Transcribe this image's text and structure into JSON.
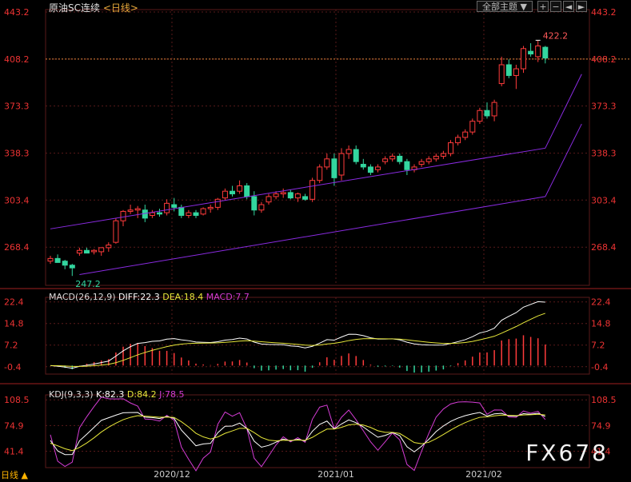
{
  "header": {
    "instrument": "原油SC连续",
    "period": "<日线>",
    "theme_button": "全部主题",
    "theme_arrow": "▼",
    "tool_icons": [
      "plus-icon",
      "minus-icon",
      "left-icon",
      "right-icon"
    ]
  },
  "macd": {
    "label": "MACD(26,12,9)",
    "diff": "DIFF:22.3",
    "dea": "DEA:18.4",
    "macd": "MACD:7.7"
  },
  "kdj": {
    "label": "KDJ(9,3,3)",
    "k": "K:82.3",
    "d": "D:84.2",
    "j": "J:78.5"
  },
  "watermark": "FX678",
  "corner": "日线 ▲",
  "colors": {
    "up": "#ff3b3b",
    "down": "#33d69f",
    "grid": "#5a1a1a",
    "channel": "#8a2be2",
    "diff": "#ffffff",
    "dea": "#e8e83a",
    "j": "#d43cd4",
    "axis": "#e33"
  },
  "chart_data": [
    {
      "type": "candlestick",
      "title": "原油SC连续 <日线>",
      "ylim": [
        240,
        445
      ],
      "yticks": [
        "443.2",
        "408.2",
        "373.3",
        "338.3",
        "303.4",
        "268.4"
      ],
      "xticks": [
        "2020/12",
        "2021/01",
        "2021/02"
      ],
      "annotations": {
        "high": "422.2",
        "low": "247.2"
      },
      "last_price": "408.2",
      "candles": [
        [
          258,
          262,
          256,
          260
        ],
        [
          260,
          263,
          258,
          257
        ],
        [
          258,
          259,
          252,
          255
        ],
        [
          255,
          256,
          247,
          253
        ],
        [
          264,
          268,
          262,
          266
        ],
        [
          266,
          268,
          264,
          264
        ],
        [
          265,
          267,
          263,
          266
        ],
        [
          265,
          268,
          262,
          268
        ],
        [
          268,
          272,
          265,
          270
        ],
        [
          272,
          290,
          271,
          288
        ],
        [
          288,
          296,
          284,
          295
        ],
        [
          295,
          300,
          293,
          296
        ],
        [
          296,
          299,
          290,
          297
        ],
        [
          296,
          300,
          287,
          290
        ],
        [
          292,
          296,
          290,
          294
        ],
        [
          294,
          297,
          291,
          293
        ],
        [
          294,
          304,
          292,
          301
        ],
        [
          300,
          305,
          295,
          298
        ],
        [
          298,
          300,
          290,
          292
        ],
        [
          292,
          296,
          290,
          294
        ],
        [
          294,
          296,
          290,
          292
        ],
        [
          293,
          298,
          292,
          297
        ],
        [
          297,
          300,
          294,
          298
        ],
        [
          298,
          305,
          296,
          304
        ],
        [
          305,
          312,
          303,
          310
        ],
        [
          310,
          314,
          306,
          308
        ],
        [
          310,
          318,
          308,
          314
        ],
        [
          314,
          316,
          304,
          306
        ],
        [
          306,
          310,
          292,
          296
        ],
        [
          296,
          302,
          294,
          300
        ],
        [
          302,
          308,
          300,
          306
        ],
        [
          306,
          310,
          304,
          308
        ],
        [
          308,
          312,
          305,
          309
        ],
        [
          309,
          311,
          304,
          305
        ],
        [
          305,
          309,
          302,
          308
        ],
        [
          306,
          308,
          303,
          304
        ],
        [
          304,
          320,
          302,
          318
        ],
        [
          318,
          330,
          316,
          328
        ],
        [
          328,
          338,
          326,
          334
        ],
        [
          334,
          338,
          314,
          320
        ],
        [
          322,
          342,
          318,
          338
        ],
        [
          338,
          344,
          334,
          341
        ],
        [
          341,
          344,
          330,
          332
        ],
        [
          330,
          334,
          326,
          328
        ],
        [
          328,
          330,
          322,
          324
        ],
        [
          326,
          330,
          324,
          328
        ],
        [
          332,
          336,
          330,
          334
        ],
        [
          334,
          338,
          332,
          336
        ],
        [
          336,
          338,
          330,
          332
        ],
        [
          332,
          334,
          322,
          326
        ],
        [
          326,
          330,
          324,
          328
        ],
        [
          330,
          334,
          328,
          332
        ],
        [
          332,
          336,
          330,
          334
        ],
        [
          334,
          338,
          332,
          336
        ],
        [
          336,
          340,
          334,
          338
        ],
        [
          338,
          348,
          336,
          346
        ],
        [
          346,
          352,
          344,
          350
        ],
        [
          350,
          356,
          348,
          354
        ],
        [
          354,
          364,
          352,
          362
        ],
        [
          362,
          372,
          360,
          370
        ],
        [
          370,
          376,
          364,
          366
        ],
        [
          366,
          378,
          362,
          376
        ],
        [
          390,
          410,
          388,
          404
        ],
        [
          404,
          408,
          394,
          396
        ],
        [
          396,
          404,
          386,
          401
        ],
        [
          401,
          418,
          398,
          416
        ],
        [
          414,
          420,
          410,
          412
        ],
        [
          410,
          422,
          406,
          418
        ],
        [
          417,
          418,
          405,
          409
        ]
      ],
      "channel": {
        "upper": [
          [
            0,
            282
          ],
          [
            68,
            342
          ],
          [
            73,
            397
          ]
        ],
        "lower": [
          [
            4,
            248
          ],
          [
            68,
            306
          ],
          [
            73,
            360
          ]
        ]
      }
    },
    {
      "type": "line+bar",
      "title": "MACD(26,12,9)",
      "ylim": [
        -3,
        24
      ],
      "yticks": [
        "22.4",
        "14.8",
        "7.2",
        "-0.4"
      ],
      "series": [
        {
          "name": "DIFF",
          "values": []
        },
        {
          "name": "DEA",
          "values": []
        },
        {
          "name": "MACD",
          "values": []
        }
      ]
    },
    {
      "type": "line",
      "title": "KDJ(9,3,3)",
      "ylim": [
        20,
        115
      ],
      "yticks": [
        "108.5",
        "74.9",
        "41.4"
      ],
      "series": [
        {
          "name": "K",
          "values": []
        },
        {
          "name": "D",
          "values": []
        },
        {
          "name": "J",
          "values": []
        }
      ]
    }
  ]
}
